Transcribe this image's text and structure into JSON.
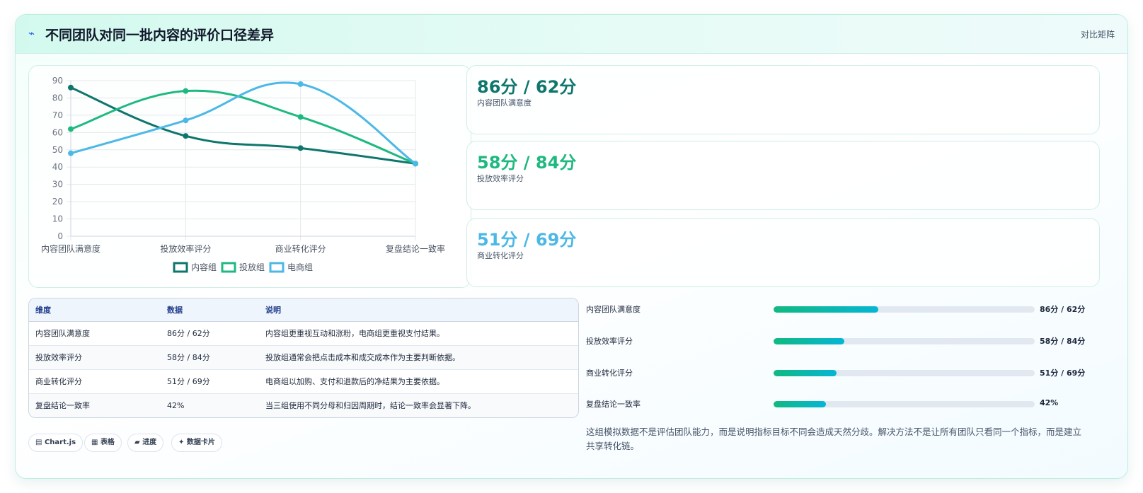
{
  "header": {
    "icon": "bolt-icon",
    "title": "不同团队对同一批内容的评价口径差异",
    "tag": "对比矩阵"
  },
  "colors": {
    "content_team": "#0f766e",
    "ads_team": "#1eb980",
    "ecom_team": "#4cb8e6",
    "bar_start": "#10b981",
    "bar_end": "#06b6d4"
  },
  "chart_data": {
    "type": "line",
    "categories": [
      "内容团队满意度",
      "投放效率评分",
      "商业转化评分",
      "复盘结论一致率"
    ],
    "series": [
      {
        "name": "内容组",
        "color": "#0f766e",
        "values": [
          86,
          58,
          51,
          42
        ]
      },
      {
        "name": "投放组",
        "color": "#1eb980",
        "values": [
          62,
          84,
          69,
          42
        ]
      },
      {
        "name": "电商组",
        "color": "#4cb8e6",
        "values": [
          48,
          67,
          88,
          42
        ]
      }
    ],
    "ylim": [
      0,
      90
    ],
    "yticks": [
      "0",
      "10",
      "20",
      "30",
      "40",
      "50",
      "60",
      "70",
      "80",
      "90"
    ],
    "grid": true,
    "smooth": true,
    "legend": "bottom"
  },
  "stats": [
    {
      "value": "86分 / 62分",
      "label": "内容团队满意度",
      "color": "#0f766e"
    },
    {
      "value": "58分 / 84分",
      "label": "投放效率评分",
      "color": "#1eb980"
    },
    {
      "value": "51分 / 69分",
      "label": "商业转化评分",
      "color": "#4cb8e6"
    }
  ],
  "table": {
    "headers": [
      "维度",
      "数据",
      "说明"
    ],
    "rows": [
      [
        "内容团队满意度",
        "86分 / 62分",
        "内容组更重视互动和涨粉，电商组更重视支付结果。"
      ],
      [
        "投放效率评分",
        "58分 / 84分",
        "投放组通常会把点击成本和成交成本作为主要判断依据。"
      ],
      [
        "商业转化评分",
        "51分 / 69分",
        "电商组以加购、支付和退款后的净结果为主要依据。"
      ],
      [
        "复盘结论一致率",
        "42%",
        "当三组使用不同分母和归因周期时，结论一致率会显著下降。"
      ]
    ]
  },
  "chips": [
    {
      "icon": "chart-icon",
      "glyph": "▤",
      "label": "Chart.js"
    },
    {
      "icon": "table-icon",
      "glyph": "▦",
      "label": "表格"
    },
    {
      "icon": "progress-icon",
      "glyph": "▰",
      "label": "进度"
    },
    {
      "icon": "sparkle-icon",
      "glyph": "✦",
      "label": "数据卡片"
    }
  ],
  "bars": [
    {
      "label": "内容团队满意度",
      "value": "86分 / 62分",
      "fraction": 0.4
    },
    {
      "label": "投放效率评分",
      "value": "58分 / 84分",
      "fraction": 0.27
    },
    {
      "label": "商业转化评分",
      "value": "51分 / 69分",
      "fraction": 0.24
    },
    {
      "label": "复盘结论一致率",
      "value": "42%",
      "fraction": 0.2
    }
  ],
  "note": "这组模拟数据不是评估团队能力，而是说明指标目标不同会造成天然分歧。解决方法不是让所有团队只看同一个指标，而是建立共享转化链。"
}
